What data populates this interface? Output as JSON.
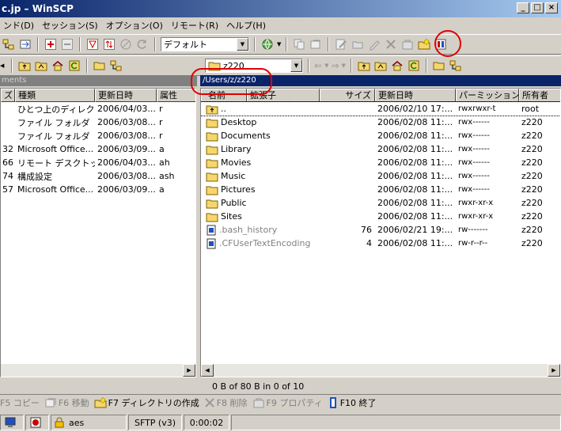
{
  "window": {
    "title": "c.jp – WinSCP",
    "min": "_",
    "max": "□",
    "close": "×"
  },
  "menu": [
    "ンド(D)",
    "セッション(S)",
    "オプション(O)",
    "リモート(R)",
    "ヘルプ(H)"
  ],
  "toolbar": {
    "profile": "デフォルト"
  },
  "remote_path_combo": "z220",
  "left_panel": {
    "path_label": "ments",
    "columns": [
      "ズ",
      "種類",
      "更新日時",
      "属性"
    ],
    "rows": [
      {
        "size": "",
        "type": "ひとつ上のディレク...",
        "date": "2006/04/03...",
        "attr": "r"
      },
      {
        "size": "",
        "type": "ファイル フォルダ",
        "date": "2006/03/08...",
        "attr": "r"
      },
      {
        "size": "",
        "type": "ファイル フォルダ",
        "date": "2006/03/08...",
        "attr": "r"
      },
      {
        "size": "32",
        "type": "Microsoft Office...",
        "date": "2006/03/09...",
        "attr": "a"
      },
      {
        "size": "66",
        "type": "リモート デスクトッ...",
        "date": "2006/04/03...",
        "attr": "ah"
      },
      {
        "size": "74",
        "type": "構成設定",
        "date": "2006/03/08...",
        "attr": "ash"
      },
      {
        "size": "57",
        "type": "Microsoft Office...",
        "date": "2006/03/09...",
        "attr": "a"
      }
    ]
  },
  "right_panel": {
    "path": "/Users/z/z220",
    "columns": [
      "名前",
      "拡張子",
      "サイズ",
      "更新日時",
      "パーミッション",
      "所有者"
    ],
    "rows": [
      {
        "name": "..",
        "size": "",
        "date": "2006/02/10 17:...",
        "perm": "rwxrwxr-t",
        "owner": "root",
        "kind": "up"
      },
      {
        "name": "Desktop",
        "size": "",
        "date": "2006/02/08 11:...",
        "perm": "rwx------",
        "owner": "z220",
        "kind": "folder"
      },
      {
        "name": "Documents",
        "size": "",
        "date": "2006/02/08 11:...",
        "perm": "rwx------",
        "owner": "z220",
        "kind": "folder"
      },
      {
        "name": "Library",
        "size": "",
        "date": "2006/02/08 11:...",
        "perm": "rwx------",
        "owner": "z220",
        "kind": "folder"
      },
      {
        "name": "Movies",
        "size": "",
        "date": "2006/02/08 11:...",
        "perm": "rwx------",
        "owner": "z220",
        "kind": "folder"
      },
      {
        "name": "Music",
        "size": "",
        "date": "2006/02/08 11:...",
        "perm": "rwx------",
        "owner": "z220",
        "kind": "folder"
      },
      {
        "name": "Pictures",
        "size": "",
        "date": "2006/02/08 11:...",
        "perm": "rwx------",
        "owner": "z220",
        "kind": "folder"
      },
      {
        "name": "Public",
        "size": "",
        "date": "2006/02/08 11:...",
        "perm": "rwxr-xr-x",
        "owner": "z220",
        "kind": "folder"
      },
      {
        "name": "Sites",
        "size": "",
        "date": "2006/02/08 11:...",
        "perm": "rwxr-xr-x",
        "owner": "z220",
        "kind": "folder"
      },
      {
        "name": ".bash_history",
        "size": "76",
        "date": "2006/02/21 19:...",
        "perm": "rw-------",
        "owner": "z220",
        "kind": "file"
      },
      {
        "name": ".CFUserTextEncoding",
        "size": "4",
        "date": "2006/02/08 11:...",
        "perm": "rw-r--r--",
        "owner": "z220",
        "kind": "file"
      }
    ]
  },
  "info": "0 B of 80 B in 0 of 10",
  "fkeys": [
    {
      "label": "F5 コピー",
      "enabled": false
    },
    {
      "label": "F6 移動",
      "enabled": false
    },
    {
      "label": "F7 ディレクトリの作成",
      "enabled": true
    },
    {
      "label": "F8 削除",
      "enabled": false
    },
    {
      "label": "F9 プロパティ",
      "enabled": false
    },
    {
      "label": "F10 終了",
      "enabled": true
    }
  ],
  "status": {
    "cipher": "aes",
    "protocol": "SFTP (v3)",
    "time": "0:00:02"
  }
}
